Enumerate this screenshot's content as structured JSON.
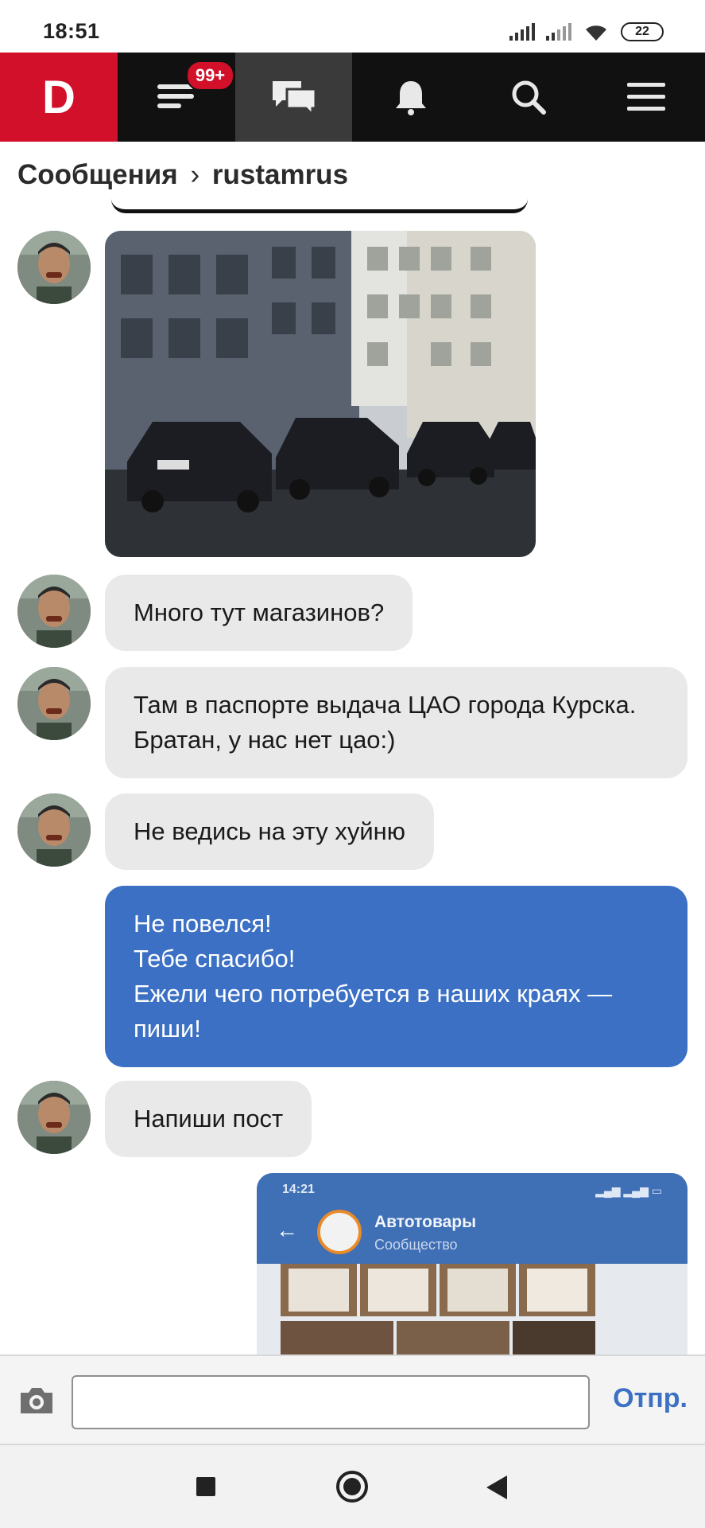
{
  "status_bar": {
    "time": "18:51",
    "battery": "22"
  },
  "nav": {
    "logo": "D",
    "badge": "99+"
  },
  "breadcrumb": {
    "section": "Сообщения",
    "separator": "›",
    "user": "rustamrus"
  },
  "messages": [
    {
      "type": "image",
      "direction": "in"
    },
    {
      "type": "text",
      "direction": "in",
      "text": "Много тут магазинов?"
    },
    {
      "type": "text",
      "direction": "in",
      "text": "Там в паспорте выдача ЦАО города Курска. Братан, у нас нет цао:)"
    },
    {
      "type": "text",
      "direction": "in",
      "text": "Не ведись на эту хуйню"
    },
    {
      "type": "text",
      "direction": "out",
      "text": "Не повелся!\nТебе спасибо!\nЕжели чего потребуется в наших краях — пиши!"
    },
    {
      "type": "text",
      "direction": "in",
      "text": "Напиши пост"
    },
    {
      "type": "image",
      "direction": "out"
    }
  ],
  "embedded_screenshot": {
    "time": "14:21",
    "title": "Автотовары",
    "subtitle": "Сообщество"
  },
  "composer": {
    "value": "",
    "send_label": "Отпр."
  },
  "colors": {
    "brand_red": "#d3102a",
    "outgoing_bubble": "#3b70c4",
    "incoming_bubble": "#e9e9e9",
    "nav_bg": "#111111"
  }
}
